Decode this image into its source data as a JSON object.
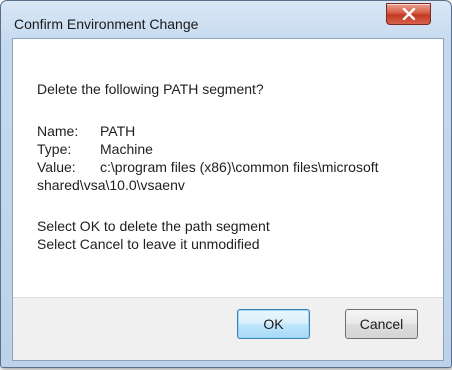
{
  "dialog": {
    "title": "Confirm Environment Change",
    "close_glyph": "X",
    "question": "Delete the following PATH segment?",
    "details": {
      "name_label": "Name:",
      "name_value": "PATH",
      "type_label": "Type:",
      "type_value": "Machine",
      "value_label": "Value:",
      "value_line1": "c:\\program files (x86)\\common files\\microsoft",
      "value_line2": "shared\\vsa\\10.0\\vsaenv"
    },
    "instructions": {
      "ok_hint": "Select OK to delete the path segment",
      "cancel_hint": "Select Cancel to leave it unmodified"
    },
    "buttons": {
      "ok_label": "OK",
      "cancel_label": "Cancel"
    }
  },
  "colors": {
    "titlebar": "#c5d9ee",
    "close_button": "#c94a33",
    "default_button_border": "#3c7fb1",
    "footer": "#f0f0f0"
  },
  "icons": {
    "close": "close-icon"
  }
}
